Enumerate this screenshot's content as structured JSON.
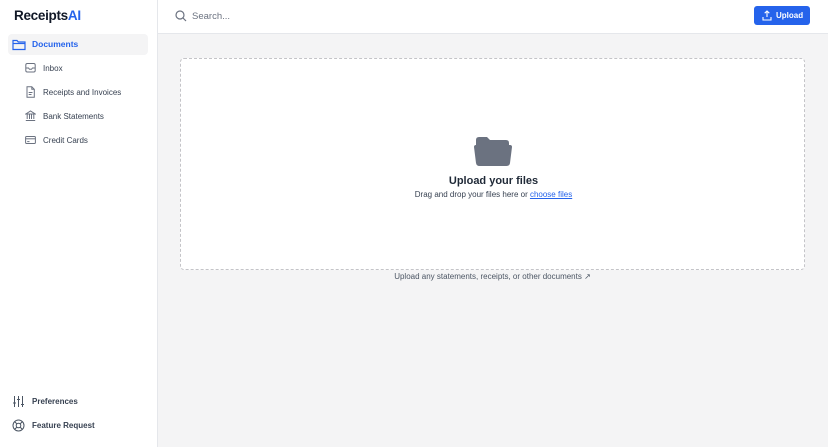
{
  "app": {
    "logo_main": "Receipts",
    "logo_accent": "AI",
    "accent_color": "#2563eb"
  },
  "sidebar": {
    "section": {
      "label": "Documents",
      "icon": "folder-icon"
    },
    "items": [
      {
        "label": "Inbox",
        "icon": "inbox-icon"
      },
      {
        "label": "Receipts and Invoices",
        "icon": "document-icon"
      },
      {
        "label": "Bank Statements",
        "icon": "bank-icon"
      },
      {
        "label": "Credit Cards",
        "icon": "credit-card-icon"
      }
    ],
    "bottom": [
      {
        "label": "Preferences",
        "icon": "sliders-icon"
      },
      {
        "label": "Feature Request",
        "icon": "lifebuoy-icon"
      }
    ]
  },
  "topbar": {
    "search_placeholder": "Search...",
    "upload_label": "Upload"
  },
  "dropzone": {
    "title": "Upload your files",
    "subtitle_prefix": "Drag and drop your files here or ",
    "link_label": "choose files",
    "hint": "Upload any statements, receipts, or other documents ↗"
  }
}
